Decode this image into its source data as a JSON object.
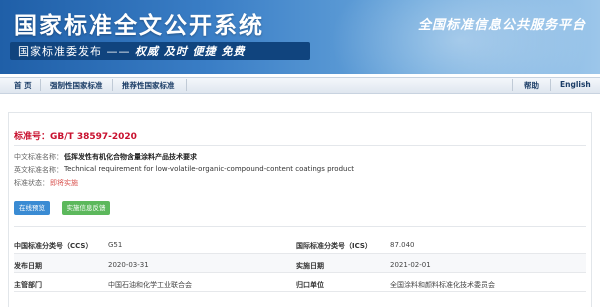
{
  "banner": {
    "title": "国家标准全文公开系统",
    "subtitle_left": "国家标准委发布 ——",
    "subtitle_right": "权威 及时 便捷 免费",
    "slogan": "全国标准信息公共服务平台"
  },
  "nav": {
    "home": "首 页",
    "mandatory": "强制性国家标准",
    "recommended": "推荐性国家标准",
    "help": "帮助",
    "english": "English"
  },
  "standard": {
    "number_label": "标准号：",
    "number": "GB/T 38597-2020",
    "cn_name_label": "中文标准名称：",
    "cn_name": "低挥发性有机化合物含量涂料产品技术要求",
    "en_name_label": "英文标准名称：",
    "en_name": "Technical requirement for low-volatile-organic-compound-content coatings product",
    "status_label": "标准状态：",
    "status": "即将实施"
  },
  "buttons": {
    "preview": "在线预览",
    "feedback": "实施信息反馈"
  },
  "details": {
    "ccs_label": "中国标准分类号（CCS）",
    "ccs": "G51",
    "ics_label": "国际标准分类号（ICS）",
    "ics": "87.040",
    "publish_label": "发布日期",
    "publish": "2020-03-31",
    "implement_label": "实施日期",
    "implement": "2021-02-01",
    "authority_label": "主管部门",
    "authority": "中国石油和化学工业联合会",
    "owner_label": "归口单位",
    "owner": "全国涂料和颜料标准化技术委员会"
  },
  "colors": {
    "banner_blue": "#1f5fa8",
    "accent_red": "#c8102e",
    "button_blue": "#3a8bd3",
    "button_green": "#5cb85c"
  }
}
